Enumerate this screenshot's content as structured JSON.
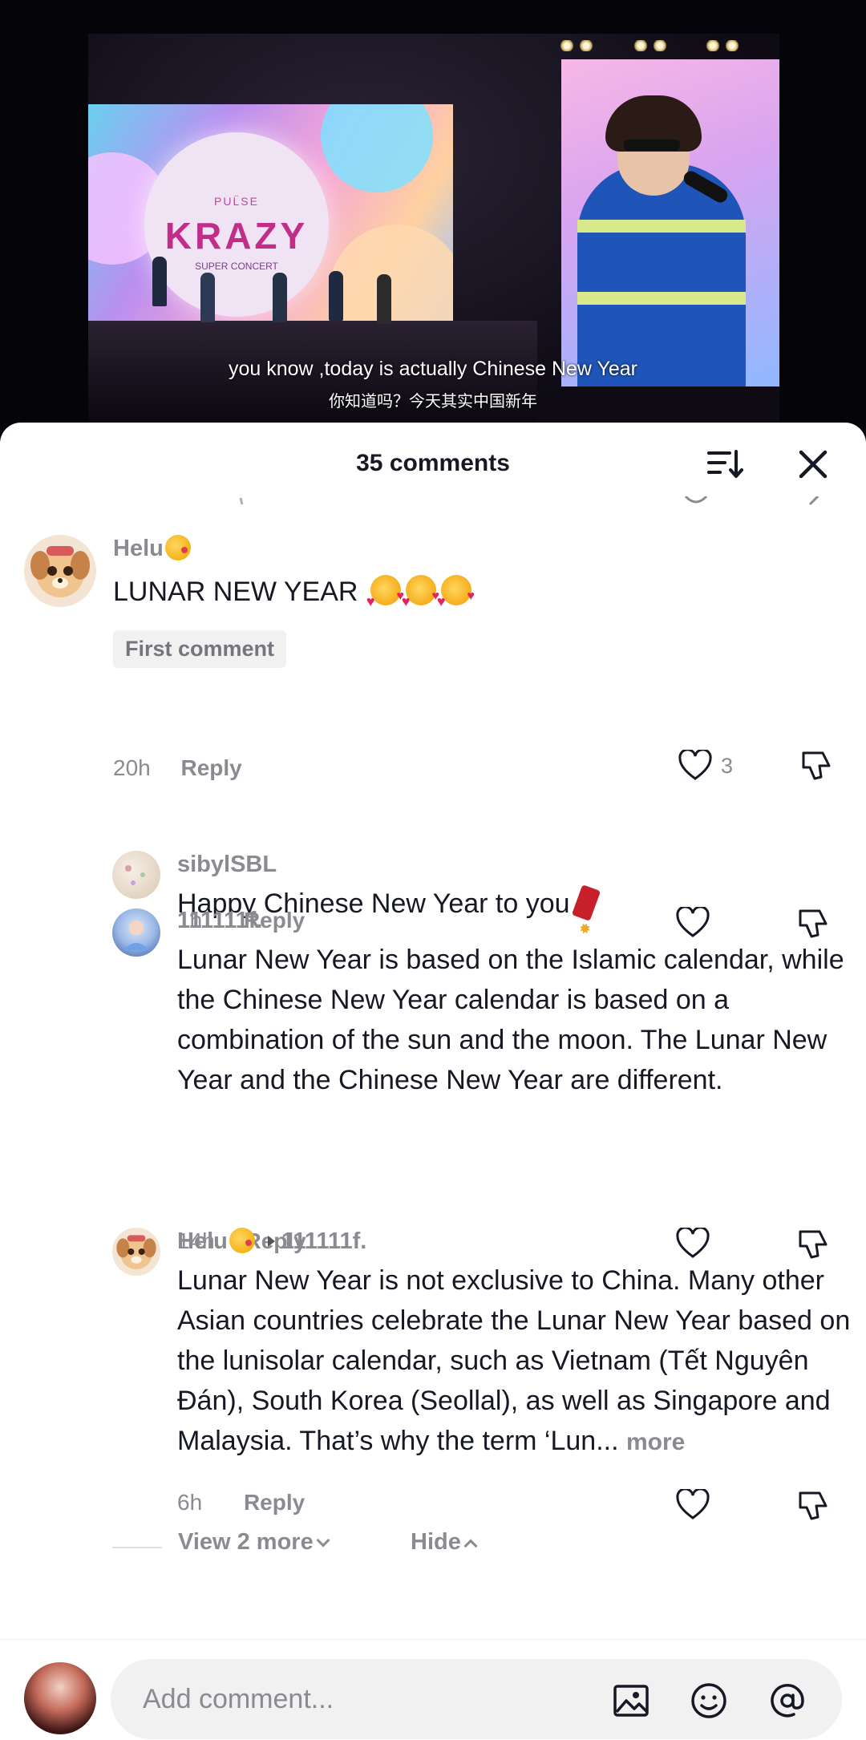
{
  "video": {
    "logo_brand": "PUL̈SE",
    "logo_title": "KRAZY",
    "logo_sub": "SUPER CONCERT",
    "subtitle_en": "you know ,today is actually Chinese New Year",
    "subtitle_zh": "你知道吗？今天其实中国新年"
  },
  "sheet": {
    "title": "35 comments",
    "sort_icon": "sort-icon",
    "close_icon": "close-icon"
  },
  "comments": [
    {
      "username": "Helu",
      "text": "LUNAR NEW YEAR",
      "badge": "First comment",
      "time": "20h",
      "reply_label": "Reply",
      "likes": "3"
    },
    {
      "username": "sibylSBL",
      "text": "Happy Chinese New Year to you",
      "time": "1h",
      "reply_label": "Reply"
    },
    {
      "username": "111111f.",
      "text": "Lunar New Year is based on the Islamic calendar, while the Chinese New Year calendar is based on a combination of the sun and the moon. The Lunar New Year and the Chinese New Year are different.",
      "time": "14h",
      "reply_label": "Reply"
    },
    {
      "username": "Helu",
      "reply_to": "111111f.",
      "text": "Lunar New Year is not exclusive to China. Many other Asian countries celebrate the Lunar New Year based on the lunisolar calendar, such as Vietnam (Tết Nguyên Đán), South Korea (Seollal), as well as Singapore and Malaysia. That’s why the term ‘Lun...",
      "more_label": "more",
      "time": "6h",
      "reply_label": "Reply"
    }
  ],
  "thread_controls": {
    "view_more": "View 2 more",
    "hide": "Hide"
  },
  "composer": {
    "placeholder": "Add comment..."
  },
  "colors": {
    "text_primary": "#161823",
    "text_secondary": "#8a8b91",
    "badge_bg": "#f1f1f2"
  }
}
